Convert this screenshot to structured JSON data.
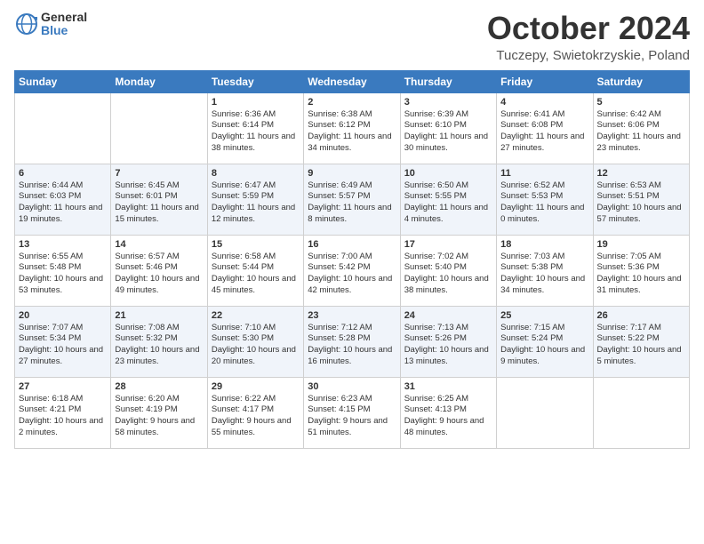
{
  "header": {
    "logo_general": "General",
    "logo_blue": "Blue",
    "month": "October 2024",
    "location": "Tuczepy, Swietokrzyskie, Poland"
  },
  "days_of_week": [
    "Sunday",
    "Monday",
    "Tuesday",
    "Wednesday",
    "Thursday",
    "Friday",
    "Saturday"
  ],
  "weeks": [
    [
      {
        "day": "",
        "info": ""
      },
      {
        "day": "",
        "info": ""
      },
      {
        "day": "1",
        "info": "Sunrise: 6:36 AM\nSunset: 6:14 PM\nDaylight: 11 hours and 38 minutes."
      },
      {
        "day": "2",
        "info": "Sunrise: 6:38 AM\nSunset: 6:12 PM\nDaylight: 11 hours and 34 minutes."
      },
      {
        "day": "3",
        "info": "Sunrise: 6:39 AM\nSunset: 6:10 PM\nDaylight: 11 hours and 30 minutes."
      },
      {
        "day": "4",
        "info": "Sunrise: 6:41 AM\nSunset: 6:08 PM\nDaylight: 11 hours and 27 minutes."
      },
      {
        "day": "5",
        "info": "Sunrise: 6:42 AM\nSunset: 6:06 PM\nDaylight: 11 hours and 23 minutes."
      }
    ],
    [
      {
        "day": "6",
        "info": "Sunrise: 6:44 AM\nSunset: 6:03 PM\nDaylight: 11 hours and 19 minutes."
      },
      {
        "day": "7",
        "info": "Sunrise: 6:45 AM\nSunset: 6:01 PM\nDaylight: 11 hours and 15 minutes."
      },
      {
        "day": "8",
        "info": "Sunrise: 6:47 AM\nSunset: 5:59 PM\nDaylight: 11 hours and 12 minutes."
      },
      {
        "day": "9",
        "info": "Sunrise: 6:49 AM\nSunset: 5:57 PM\nDaylight: 11 hours and 8 minutes."
      },
      {
        "day": "10",
        "info": "Sunrise: 6:50 AM\nSunset: 5:55 PM\nDaylight: 11 hours and 4 minutes."
      },
      {
        "day": "11",
        "info": "Sunrise: 6:52 AM\nSunset: 5:53 PM\nDaylight: 11 hours and 0 minutes."
      },
      {
        "day": "12",
        "info": "Sunrise: 6:53 AM\nSunset: 5:51 PM\nDaylight: 10 hours and 57 minutes."
      }
    ],
    [
      {
        "day": "13",
        "info": "Sunrise: 6:55 AM\nSunset: 5:48 PM\nDaylight: 10 hours and 53 minutes."
      },
      {
        "day": "14",
        "info": "Sunrise: 6:57 AM\nSunset: 5:46 PM\nDaylight: 10 hours and 49 minutes."
      },
      {
        "day": "15",
        "info": "Sunrise: 6:58 AM\nSunset: 5:44 PM\nDaylight: 10 hours and 45 minutes."
      },
      {
        "day": "16",
        "info": "Sunrise: 7:00 AM\nSunset: 5:42 PM\nDaylight: 10 hours and 42 minutes."
      },
      {
        "day": "17",
        "info": "Sunrise: 7:02 AM\nSunset: 5:40 PM\nDaylight: 10 hours and 38 minutes."
      },
      {
        "day": "18",
        "info": "Sunrise: 7:03 AM\nSunset: 5:38 PM\nDaylight: 10 hours and 34 minutes."
      },
      {
        "day": "19",
        "info": "Sunrise: 7:05 AM\nSunset: 5:36 PM\nDaylight: 10 hours and 31 minutes."
      }
    ],
    [
      {
        "day": "20",
        "info": "Sunrise: 7:07 AM\nSunset: 5:34 PM\nDaylight: 10 hours and 27 minutes."
      },
      {
        "day": "21",
        "info": "Sunrise: 7:08 AM\nSunset: 5:32 PM\nDaylight: 10 hours and 23 minutes."
      },
      {
        "day": "22",
        "info": "Sunrise: 7:10 AM\nSunset: 5:30 PM\nDaylight: 10 hours and 20 minutes."
      },
      {
        "day": "23",
        "info": "Sunrise: 7:12 AM\nSunset: 5:28 PM\nDaylight: 10 hours and 16 minutes."
      },
      {
        "day": "24",
        "info": "Sunrise: 7:13 AM\nSunset: 5:26 PM\nDaylight: 10 hours and 13 minutes."
      },
      {
        "day": "25",
        "info": "Sunrise: 7:15 AM\nSunset: 5:24 PM\nDaylight: 10 hours and 9 minutes."
      },
      {
        "day": "26",
        "info": "Sunrise: 7:17 AM\nSunset: 5:22 PM\nDaylight: 10 hours and 5 minutes."
      }
    ],
    [
      {
        "day": "27",
        "info": "Sunrise: 6:18 AM\nSunset: 4:21 PM\nDaylight: 10 hours and 2 minutes."
      },
      {
        "day": "28",
        "info": "Sunrise: 6:20 AM\nSunset: 4:19 PM\nDaylight: 9 hours and 58 minutes."
      },
      {
        "day": "29",
        "info": "Sunrise: 6:22 AM\nSunset: 4:17 PM\nDaylight: 9 hours and 55 minutes."
      },
      {
        "day": "30",
        "info": "Sunrise: 6:23 AM\nSunset: 4:15 PM\nDaylight: 9 hours and 51 minutes."
      },
      {
        "day": "31",
        "info": "Sunrise: 6:25 AM\nSunset: 4:13 PM\nDaylight: 9 hours and 48 minutes."
      },
      {
        "day": "",
        "info": ""
      },
      {
        "day": "",
        "info": ""
      }
    ]
  ]
}
